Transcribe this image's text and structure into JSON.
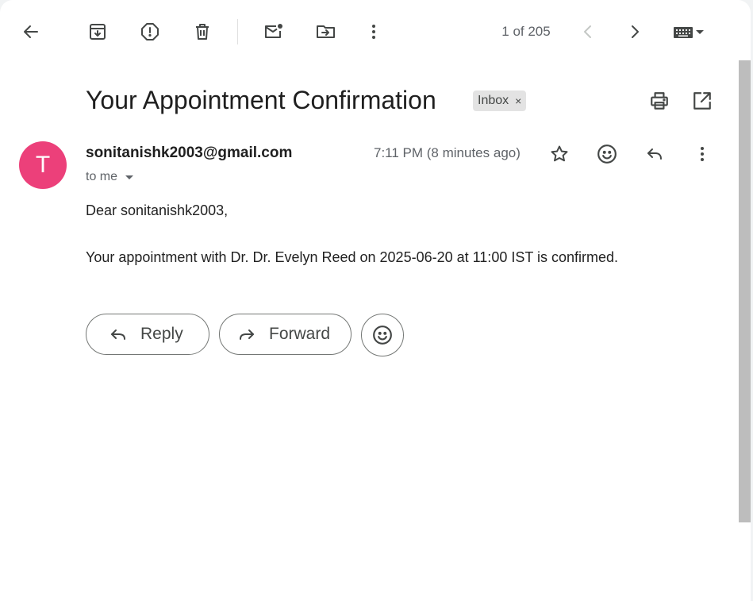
{
  "toolbar": {
    "counter": "1 of 205"
  },
  "message": {
    "subject": "Your Appointment Confirmation",
    "label": "Inbox",
    "label_remove": "×",
    "avatar_letter": "T",
    "sender": "sonitanishk2003@gmail.com",
    "time": "7:11 PM (8 minutes ago)",
    "recipient": "to me",
    "body": [
      "Dear sonitanishk2003,",
      "Your appointment with Dr. Dr. Evelyn Reed on 2025-06-20 at 11:00 IST is confirmed."
    ]
  },
  "actions": {
    "reply_label": "Reply",
    "forward_label": "Forward"
  },
  "colors": {
    "avatar": "#ec407a",
    "icon": "#444746",
    "label_chip": "#e3e3e3"
  }
}
